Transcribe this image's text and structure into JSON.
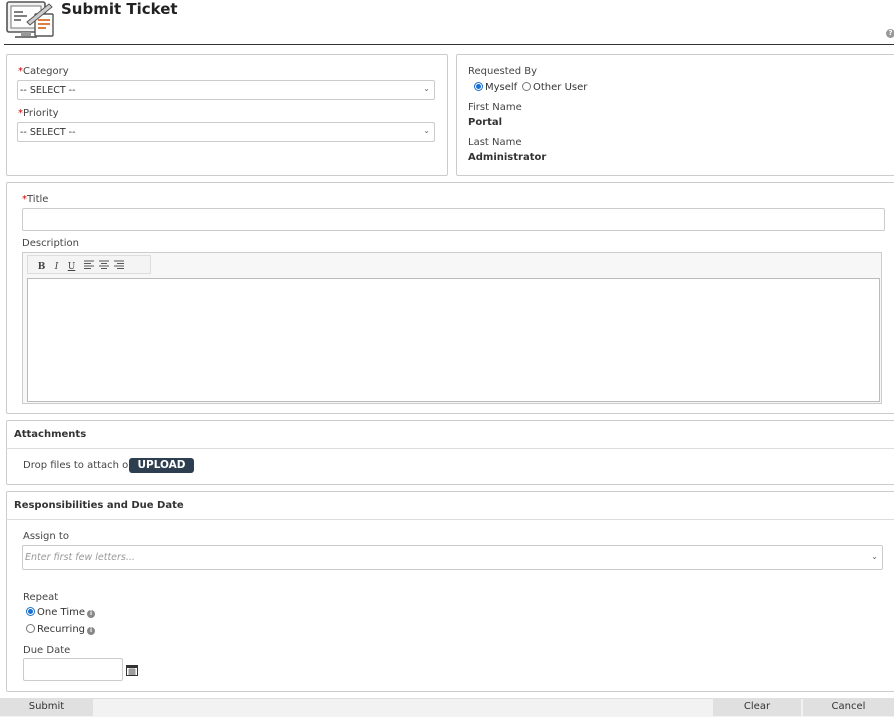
{
  "header": {
    "title": "Submit Ticket",
    "help_glyph": "?"
  },
  "form": {
    "required_mark": "*",
    "category": {
      "label": "Category",
      "value": "-- SELECT --"
    },
    "priority": {
      "label": "Priority",
      "value": "-- SELECT --"
    },
    "title_field": {
      "label": "Title",
      "value": ""
    },
    "description": {
      "label": "Description",
      "toolbar": [
        "B",
        "I",
        "U"
      ]
    }
  },
  "requester": {
    "label": "Requested By",
    "options": [
      "Myself",
      "Other User"
    ],
    "selected": "Myself",
    "first_name_label": "First Name",
    "first_name": "Portal",
    "last_name_label": "Last Name",
    "last_name": "Administrator"
  },
  "attachments": {
    "title": "Attachments",
    "drop_text": "Drop files to attach or",
    "upload_label": "UPLOAD"
  },
  "responsibilities": {
    "title": "Responsibilities and Due Date",
    "assign_label": "Assign to",
    "assign_placeholder": "Enter first few letters...",
    "repeat_label": "Repeat",
    "repeat_options": [
      "One Time",
      "Recurring"
    ],
    "repeat_selected": "One Time",
    "due_date_label": "Due Date",
    "due_date_value": ""
  },
  "footer": {
    "submit": "Submit",
    "clear": "Clear",
    "cancel": "Cancel"
  }
}
